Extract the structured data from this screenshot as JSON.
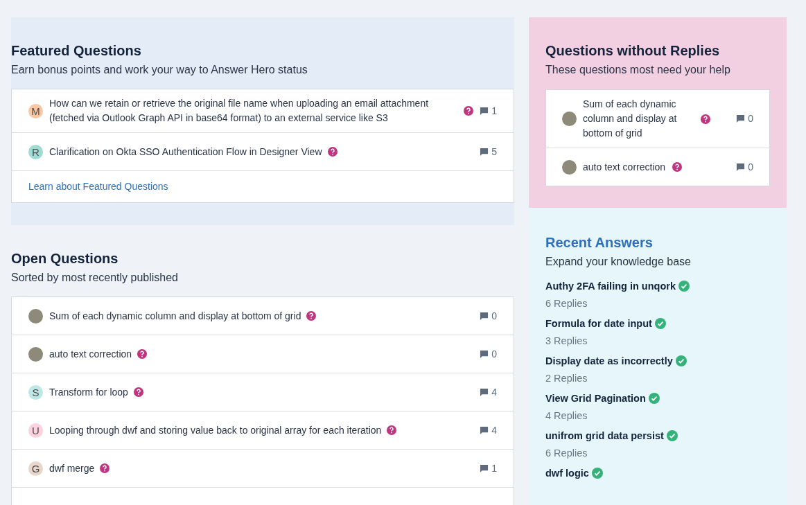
{
  "featured": {
    "title": "Featured Questions",
    "subtitle": "Earn bonus points and work your way to Answer Hero status",
    "questions": [
      {
        "avatar": {
          "kind": "letter",
          "letter": "M",
          "color": "#f9c8a3"
        },
        "text": "How can we retain or retrieve the original file name when uploading an email attachment (fetched via Outlook Graph API in base64 format) to an external service like S3",
        "replies": "1"
      },
      {
        "avatar": {
          "kind": "letter",
          "letter": "R",
          "color": "#9fdcd3"
        },
        "text": "Clarification on Okta SSO Authentication Flow in Designer View",
        "replies": "5"
      }
    ],
    "link": "Learn about Featured Questions"
  },
  "open": {
    "title": "Open Questions",
    "subtitle": "Sorted by most recently published",
    "questions": [
      {
        "avatar": {
          "kind": "photo"
        },
        "text": "Sum of each dynamic column and display at bottom of grid",
        "replies": "0"
      },
      {
        "avatar": {
          "kind": "photo"
        },
        "text": "auto text correction",
        "replies": "0"
      },
      {
        "avatar": {
          "kind": "letter",
          "letter": "S",
          "color": "#bde8e6"
        },
        "text": "Transform for loop",
        "replies": "4"
      },
      {
        "avatar": {
          "kind": "letter",
          "letter": "U",
          "color": "#fbd2de"
        },
        "text": "Looping through dwf and storing value back to original array for each iteration",
        "replies": "4"
      },
      {
        "avatar": {
          "kind": "letter",
          "letter": "G",
          "color": "#e6d6cc"
        },
        "text": "dwf merge",
        "replies": "1"
      }
    ]
  },
  "unanswered": {
    "title": "Questions without Replies",
    "subtitle": "These questions most need your help",
    "questions": [
      {
        "avatar": {
          "kind": "photo"
        },
        "text": "Sum of each dynamic column and display at bottom of grid",
        "replies": "0"
      },
      {
        "avatar": {
          "kind": "photo"
        },
        "text": "auto text correction",
        "replies": "0"
      }
    ]
  },
  "recent": {
    "title": "Recent Answers",
    "subtitle": "Expand your knowledge base",
    "answers": [
      {
        "title": "Authy 2FA failing in unqork",
        "replies": "6 Replies"
      },
      {
        "title": "Formula for date input",
        "replies": "3 Replies"
      },
      {
        "title": "Display date as incorrectly",
        "replies": "2 Replies"
      },
      {
        "title": "View Grid Pagination",
        "replies": "4 Replies"
      },
      {
        "title": "unifrom grid data persist",
        "replies": "6 Replies"
      },
      {
        "title": "dwf logic"
      }
    ]
  }
}
